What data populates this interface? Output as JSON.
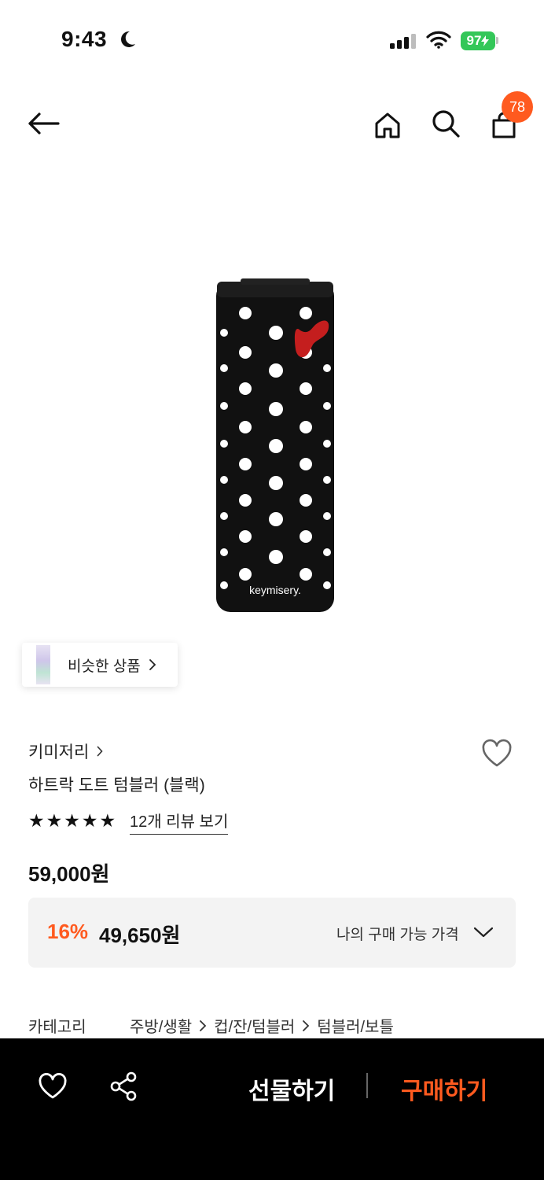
{
  "status_bar": {
    "time": "9:43",
    "battery": "97"
  },
  "header": {
    "cart_count": "78"
  },
  "product_image": {
    "brand_print": "keymisery."
  },
  "similar": {
    "label": "비슷한 상품"
  },
  "product": {
    "brand": "키미저리",
    "title": "하트락 도트 텀블러 (블랙)",
    "rating": 5,
    "review_link": "12개 리뷰 보기",
    "original_price": "59,000원",
    "discount": "16%",
    "sale_price": "49,650원",
    "my_price_label": "나의 구매 가능 가격"
  },
  "category": {
    "label": "카테고리",
    "path": [
      "주방/생활",
      "컵/잔/텀블러",
      "텀블러/보틀"
    ]
  },
  "bottom_bar": {
    "gift_label": "선물하기",
    "buy_label": "구매하기"
  },
  "colors": {
    "accent": "#ff5a1f",
    "bar": "#000000",
    "battery": "#34c759"
  }
}
